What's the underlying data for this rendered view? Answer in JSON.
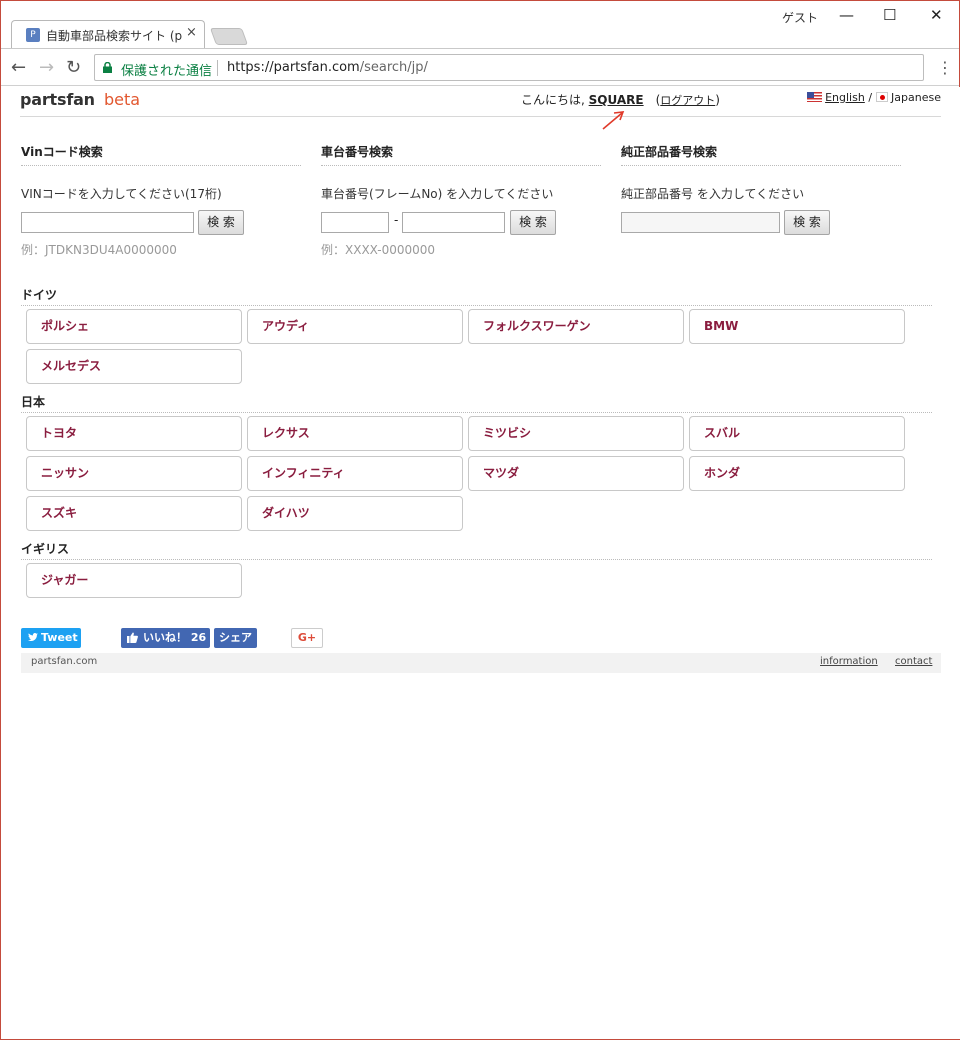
{
  "browser": {
    "tab_title": "自動車部品検索サイト (pa",
    "tab_favicon": "P",
    "tab_close": "×",
    "profile": "ゲスト",
    "minimize": "—",
    "maximize": "☐",
    "close": "✕",
    "back": "←",
    "forward": "→",
    "reload": "↻",
    "secure_label": "保護された通信",
    "url_host": "https://partsfan.com",
    "url_path": "/search/jp/",
    "menu": "⋮"
  },
  "header": {
    "logo": "partsfan",
    "logo_beta": "beta",
    "greeting_prefix": "こんにちは,",
    "username": "SQUARE",
    "logout": "ログアウト",
    "lang_en": "English",
    "lang_sep": "/",
    "lang_jp": "Japanese"
  },
  "search": {
    "vin": {
      "title": "Vinコード検索",
      "desc": "VINコードを入力してください(17桁)",
      "button": "検 索",
      "example": "例：JTDKN3DU4A0000000"
    },
    "frame": {
      "title": "車台番号検索",
      "desc": "車台番号(フレームNo) を入力してください",
      "dash": "-",
      "button": "検 索",
      "example": "例：XXXX-0000000"
    },
    "oem": {
      "title": "純正部品番号検索",
      "desc": "純正部品番号 を入力してください",
      "button": "検 索"
    }
  },
  "regions": [
    {
      "name": "ドイツ",
      "brands": [
        "ポルシェ",
        "アウディ",
        "フォルクスワーゲン",
        "BMW",
        "メルセデス"
      ]
    },
    {
      "name": "日本",
      "brands": [
        "トヨタ",
        "レクサス",
        "ミツビシ",
        "スバル",
        "ニッサン",
        "インフィニティ",
        "マツダ",
        "ホンダ",
        "スズキ",
        "ダイハツ"
      ]
    },
    {
      "name": "イギリス",
      "brands": [
        "ジャガー"
      ]
    }
  ],
  "social": {
    "tweet": "Tweet",
    "like": "いいね！ 26",
    "share": "シェア",
    "gplus": "G+"
  },
  "footer": {
    "site": "partsfan.com",
    "information": "information",
    "contact": "contact"
  },
  "colors": {
    "brand_text": "#8a1d3f",
    "beta": "#e2572f",
    "secure": "#0b8043",
    "twitter": "#1da1f2",
    "facebook": "#4267b2",
    "annotation_arrow": "#e03a2a"
  }
}
